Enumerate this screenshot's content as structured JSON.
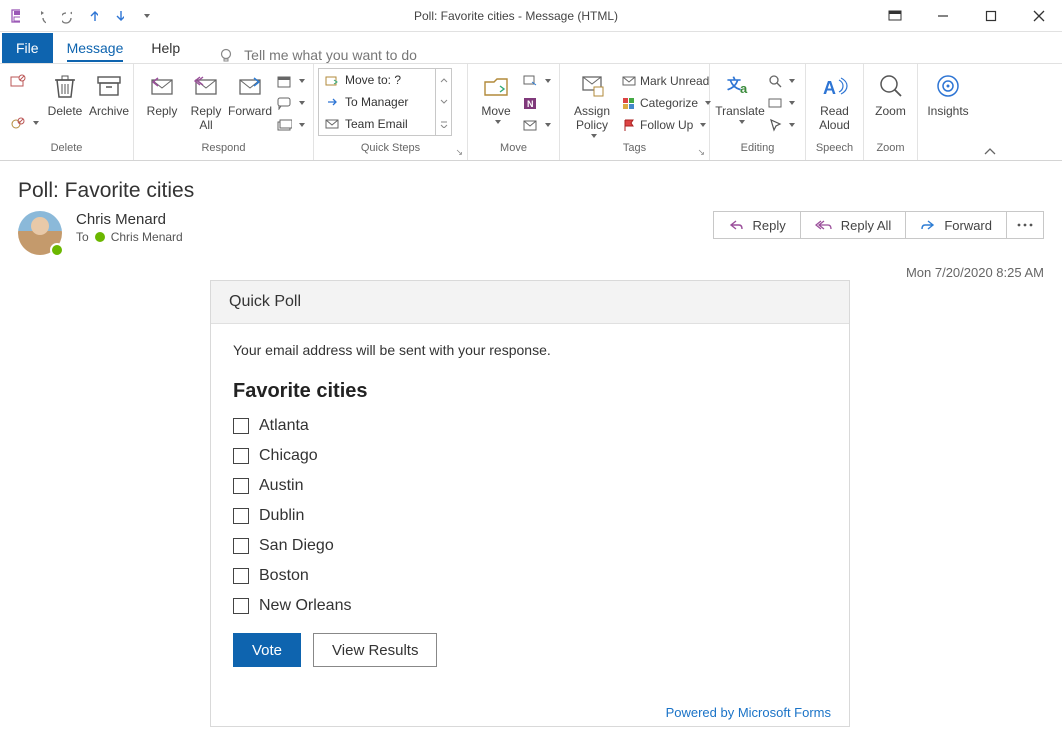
{
  "window": {
    "title": "Poll: Favorite cities  -  Message (HTML)"
  },
  "menu": {
    "file": "File",
    "message": "Message",
    "help": "Help",
    "tellme": "Tell me what you want to do"
  },
  "ribbon": {
    "delete": {
      "label": "Delete",
      "group": "Delete"
    },
    "archive": {
      "label": "Archive"
    },
    "reply": {
      "label": "Reply"
    },
    "replyall": {
      "label": "Reply\nAll"
    },
    "forward": {
      "label": "Forward"
    },
    "respond_group": "Respond",
    "qs": {
      "moveto": "Move to: ?",
      "tomanager": "To Manager",
      "teamemail": "Team Email",
      "group": "Quick Steps"
    },
    "move": {
      "label": "Move",
      "group": "Move"
    },
    "assign": {
      "label": "Assign\nPolicy"
    },
    "markunread": "Mark Unread",
    "categorize": "Categorize",
    "followup": "Follow Up",
    "tags_group": "Tags",
    "translate": "Translate",
    "editing_group": "Editing",
    "readaloud": "Read\nAloud",
    "speech_group": "Speech",
    "zoom": "Zoom",
    "zoom_group": "Zoom",
    "insights": "Insights"
  },
  "message": {
    "subject": "Poll: Favorite cities",
    "from": "Chris Menard",
    "to_label": "To",
    "to_name": "Chris Menard",
    "timestamp": "Mon 7/20/2020 8:25 AM"
  },
  "actions": {
    "reply": "Reply",
    "replyall": "Reply All",
    "forward": "Forward"
  },
  "poll": {
    "header": "Quick Poll",
    "note": "Your email address will be sent with your response.",
    "question": "Favorite cities",
    "options": [
      "Atlanta",
      "Chicago",
      "Austin",
      "Dublin",
      "San Diego",
      "Boston",
      "New Orleans"
    ],
    "vote": "Vote",
    "view": "View Results",
    "powered": "Powered by Microsoft Forms"
  }
}
